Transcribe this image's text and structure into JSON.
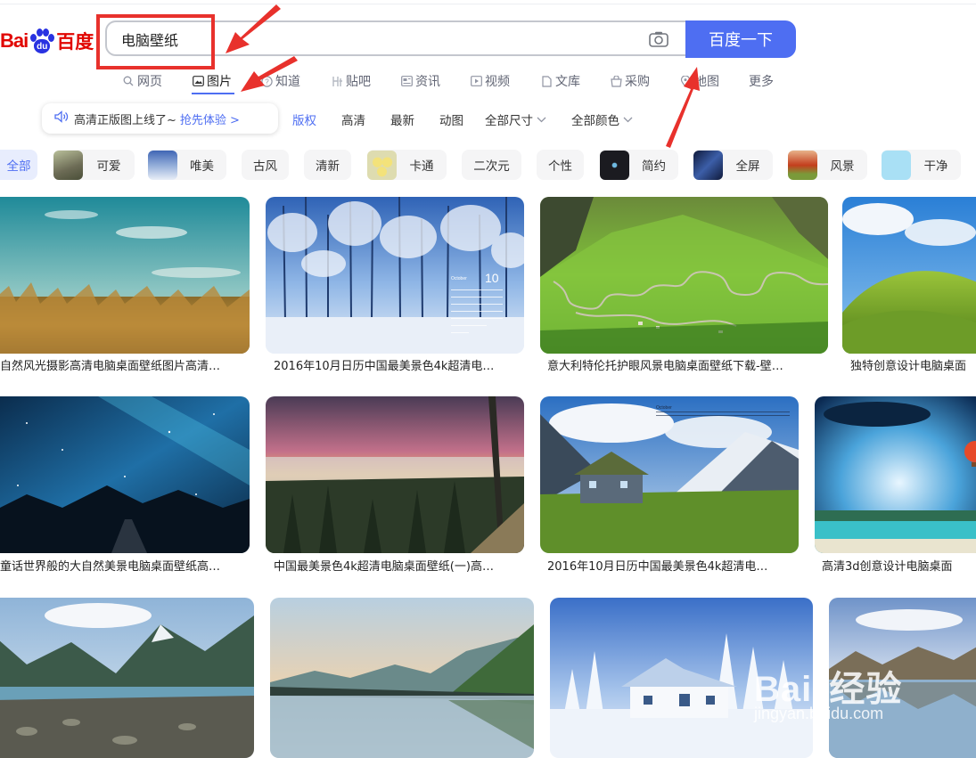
{
  "logo": {
    "bai": "Bai",
    "du": "du",
    "cn": "百度"
  },
  "search": {
    "query": "电脑壁纸",
    "button": "百度一下",
    "camera_icon": "camera-icon"
  },
  "nav": {
    "tabs": [
      {
        "label": "网页",
        "icon": "search-icon"
      },
      {
        "label": "图片",
        "icon": "image-icon",
        "active": true
      },
      {
        "label": "知道",
        "icon": "question-icon"
      },
      {
        "label": "贴吧",
        "icon": "tieba-icon"
      },
      {
        "label": "资讯",
        "icon": "news-icon"
      },
      {
        "label": "视频",
        "icon": "play-icon"
      },
      {
        "label": "文库",
        "icon": "doc-icon"
      },
      {
        "label": "采购",
        "icon": "cart-icon"
      },
      {
        "label": "地图",
        "icon": "map-pin-icon"
      },
      {
        "label": "更多",
        "icon": ""
      }
    ]
  },
  "notice": {
    "text": "高清正版图上线了~",
    "link": "抢先体验 >"
  },
  "filters": {
    "copyright": "版权",
    "hd": "高清",
    "latest": "最新",
    "animated": "动图",
    "size": "全部尺寸",
    "color": "全部颜色"
  },
  "tags": [
    {
      "label": "全部",
      "active": true
    },
    {
      "label": "可爱",
      "thumb": "#8a8a70"
    },
    {
      "label": "唯美",
      "thumb": "#5a79b3"
    },
    {
      "label": "古风"
    },
    {
      "label": "清新"
    },
    {
      "label": "卡通",
      "thumb": "#d9d8a5"
    },
    {
      "label": "二次元"
    },
    {
      "label": "个性"
    },
    {
      "label": "简约",
      "thumb": "#1b1b20"
    },
    {
      "label": "全屏",
      "thumb": "#2d4378"
    },
    {
      "label": "风景",
      "thumb": "#c64a2a"
    },
    {
      "label": "干净",
      "thumb": "#a9e0f5"
    }
  ],
  "results": [
    {
      "caption": "自然风光摄影高清电脑桌面壁纸图片高清…"
    },
    {
      "caption": "2016年10月日历中国最美景色4k超清电…"
    },
    {
      "caption": "意大利特伦托护眼风景电脑桌面壁纸下载-壁…"
    },
    {
      "caption": "独特创意设计电脑桌面"
    },
    {
      "caption": "童话世界般的大自然美景电脑桌面壁纸高…"
    },
    {
      "caption": "中国最美景色4k超清电脑桌面壁纸(一)高…"
    },
    {
      "caption": "2016年10月日历中国最美景色4k超清电…"
    },
    {
      "caption": "高清3d创意设计电脑桌面"
    }
  ],
  "calendar_overlay": {
    "month": "10",
    "label": "October"
  },
  "watermark": {
    "brand": "Bai",
    "product": "经验",
    "url": "jingyan.baidu.com"
  },
  "colors": {
    "accent": "#4e6ef2",
    "brand_red": "#e10601",
    "brand_blue": "#2932e1",
    "annotation_red": "#e8312c"
  }
}
